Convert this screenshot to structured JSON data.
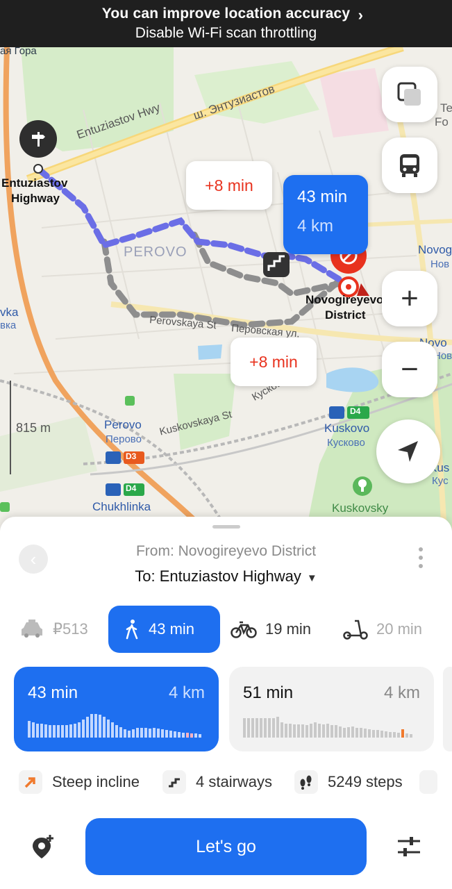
{
  "notification": {
    "line1": "You can improve location accuracy",
    "line2": "Disable Wi-Fi scan throttling",
    "chevron": "›"
  },
  "map": {
    "labels": {
      "top_left_cut": "ая Гора",
      "start_name_1": "Entuziastov",
      "start_name_2": "Highway",
      "road_entuziastov_en": "Entuziastov Hwy",
      "road_entuziastov_ru": "ш. Энтузиастов",
      "district": "PEROVO",
      "perovskaya_en": "Perovskaya St",
      "perovskaya_ru": "Перовская ул.",
      "kuskovskaya_en": "Kuskovskaya St",
      "kuskovskaya_ru": "Кусково",
      "dest_1": "Novogireyevo",
      "dest_2": "District",
      "perovo_en": "Perovo",
      "perovo_ru": "Перово",
      "d3": "D3",
      "d4_a": "D4",
      "d4_b": "D4",
      "chukhlinka": "Chukhlinka",
      "kuskovo_en": "Kuskovo",
      "kuskovo_ru": "Кусково",
      "kuskovsky": "Kuskovsky",
      "left_cut_1": "vka",
      "left_cut_2": "вка",
      "right_novog_1": "Novog",
      "right_novog_2": "Нов",
      "right_novog_3": "Novo",
      "right_novog_4": "Нов",
      "right_te": "Te",
      "right_fo": "Fo",
      "right_kus_1": "Kus",
      "right_kus_2": "Кус",
      "scale": "815 m"
    },
    "callouts": {
      "delay_top": "+8 min",
      "delay_bottom": "+8 min",
      "main_time": "43 min",
      "main_distance": "4 km"
    },
    "buttons": {
      "layers": "layers-icon",
      "transit": "bus-icon",
      "zoom_in": "+",
      "zoom_out": "−",
      "locate": "navigation-arrow-icon"
    }
  },
  "sheet": {
    "back_icon": "‹",
    "from": "From: Novogireyevo District",
    "to": "To: Entuziastov Highway",
    "to_caret": "▼",
    "modes": [
      {
        "name": "taxi",
        "label": "₽513"
      },
      {
        "name": "walk",
        "label": "43 min"
      },
      {
        "name": "bike",
        "label": "19 min"
      },
      {
        "name": "scooter",
        "label": "20 min"
      }
    ],
    "routes": [
      {
        "time": "43 min",
        "distance": "4 km"
      },
      {
        "time": "51 min",
        "distance": "4 km"
      }
    ],
    "features": {
      "incline": "Steep incline",
      "stairs": "4 stairways",
      "steps": "5249 steps"
    },
    "go_label": "Let's go"
  },
  "colors": {
    "accent": "#1e6ff0",
    "delay": "#e8321e",
    "route_walk": "#6b6ee6",
    "route_alt": "#8e8e8e"
  }
}
